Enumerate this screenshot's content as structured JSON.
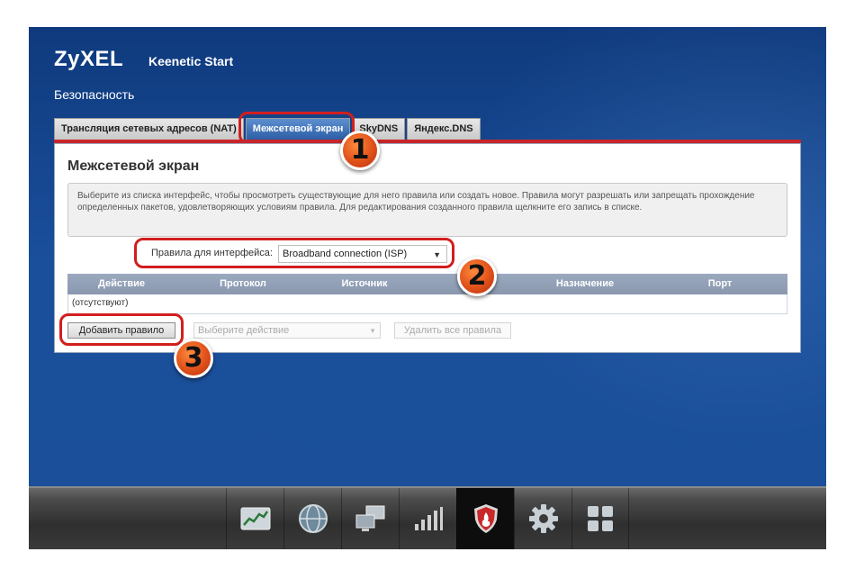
{
  "header": {
    "logo": "ZyXEL",
    "product": "Keenetic Start",
    "section": "Безопасность"
  },
  "tabs": [
    {
      "label": "Трансляция сетевых адресов (NAT)",
      "active": false
    },
    {
      "label": "Межсетевой экран",
      "active": true
    },
    {
      "label": "SkyDNS",
      "active": false
    },
    {
      "label": "Яндекс.DNS",
      "active": false
    }
  ],
  "panel": {
    "title": "Межсетевой экран",
    "info": "Выберите из списка интерфейс, чтобы просмотреть существующие для него правила или создать новое. Правила могут разрешать или запрещать прохождение определенных пакетов, удовлетворяющих условиям правила. Для редактирования созданного правила щелкните его запись в списке.",
    "interface_label": "Правила для интерфейса:",
    "interface_value": "Broadband connection (ISP)",
    "table": {
      "columns": [
        "Действие",
        "Протокол",
        "Источник",
        "Назначение",
        "Порт"
      ],
      "empty_text": "(отсутствуют)"
    },
    "actions": {
      "add_label": "Добавить правило",
      "select_placeholder": "Выберите действие",
      "delete_all_label": "Удалить все правила"
    }
  },
  "annotations": [
    "1",
    "2",
    "3"
  ],
  "taskbar": [
    "monitor-icon",
    "globe-icon",
    "network-icon",
    "wifi-signal-icon",
    "shield-icon",
    "gear-icon",
    "apps-icon"
  ],
  "colors": {
    "accent": "#c8262a",
    "tab_active": "#2d5ea5",
    "badge": "#e0501a"
  }
}
